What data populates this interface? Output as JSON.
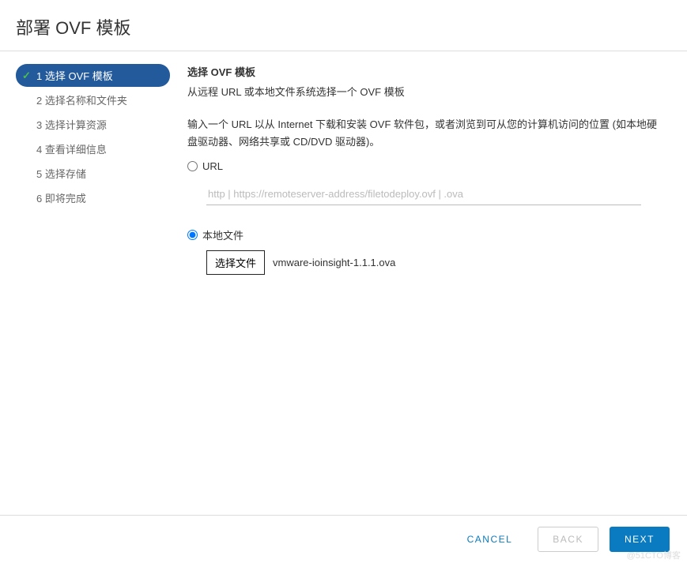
{
  "dialog": {
    "title": "部署 OVF 模板"
  },
  "sidebar": {
    "steps": [
      {
        "label": "1 选择 OVF 模板",
        "active": true,
        "checked": true
      },
      {
        "label": "2 选择名称和文件夹",
        "active": false,
        "checked": false
      },
      {
        "label": "3 选择计算资源",
        "active": false,
        "checked": false
      },
      {
        "label": "4 查看详细信息",
        "active": false,
        "checked": false
      },
      {
        "label": "5 选择存储",
        "active": false,
        "checked": false
      },
      {
        "label": "6 即将完成",
        "active": false,
        "checked": false
      }
    ]
  },
  "main": {
    "title": "选择 OVF 模板",
    "subtitle": "从远程 URL 或本地文件系统选择一个 OVF 模板",
    "description": "输入一个 URL 以从 Internet 下载和安装 OVF 软件包，或者浏览到可从您的计算机访问的位置 (如本地硬盘驱动器、网络共享或 CD/DVD 驱动器)。",
    "url_option_label": "URL",
    "url_placeholder": "http | https://remoteserver-address/filetodeploy.ovf | .ova",
    "local_option_label": "本地文件",
    "file_button_label": "选择文件",
    "selected_file": "vmware-ioinsight-1.1.1.ova",
    "selected_source": "local"
  },
  "footer": {
    "cancel": "CANCEL",
    "back": "BACK",
    "next": "NEXT"
  },
  "watermark": "@51CTO博客"
}
